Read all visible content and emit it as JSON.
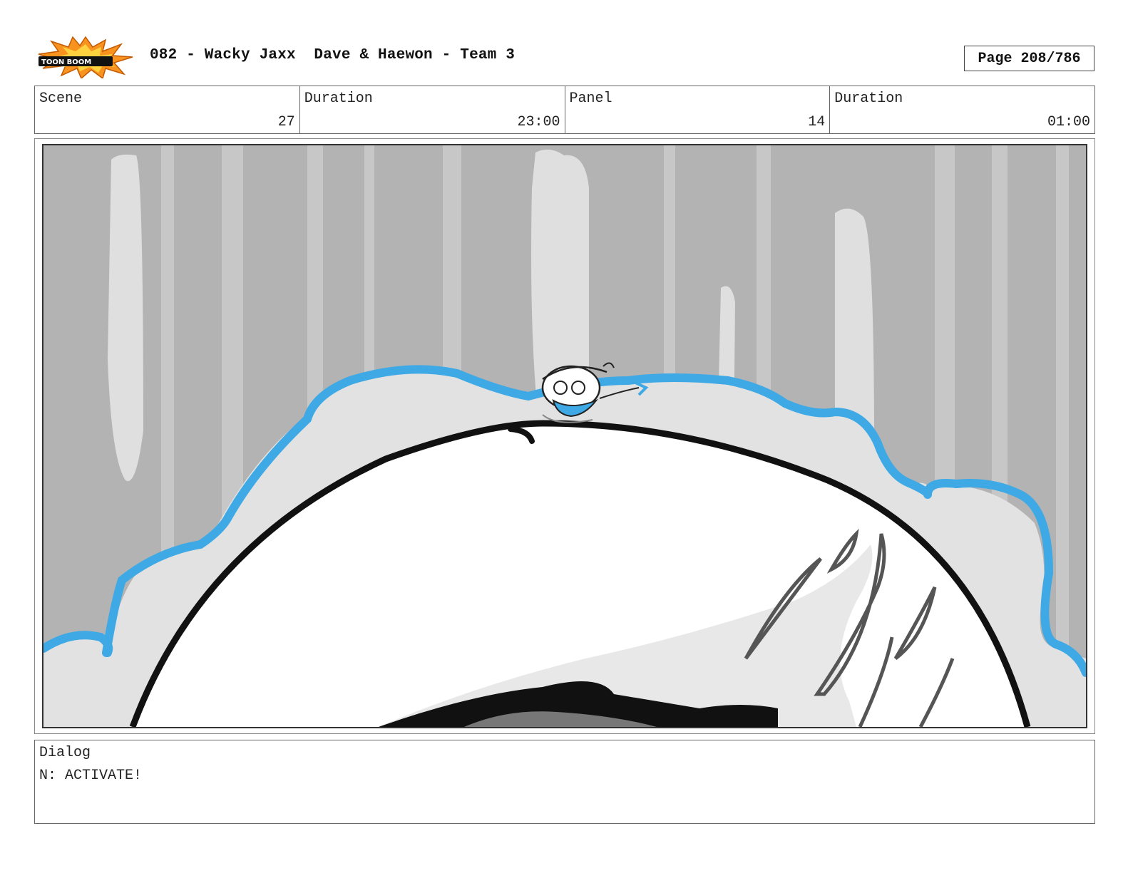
{
  "header": {
    "logo_text": "TOON BOOM",
    "title": "082 - Wacky Jaxx  Dave & Haewon - Team 3",
    "page": "Page 208/786"
  },
  "info": {
    "scene_label": "Scene",
    "scene_value": "27",
    "scene_duration_label": "Duration",
    "scene_duration_value": "23:00",
    "panel_label": "Panel",
    "panel_value": "14",
    "panel_duration_label": "Duration",
    "panel_duration_value": "01:00"
  },
  "dialog": {
    "label": "Dialog",
    "text": "N: ACTIVATE!"
  },
  "colors": {
    "accent_blue": "#3fa9e5",
    "background_gray": "#b3b3b3",
    "logo_orange": "#f7931e"
  }
}
